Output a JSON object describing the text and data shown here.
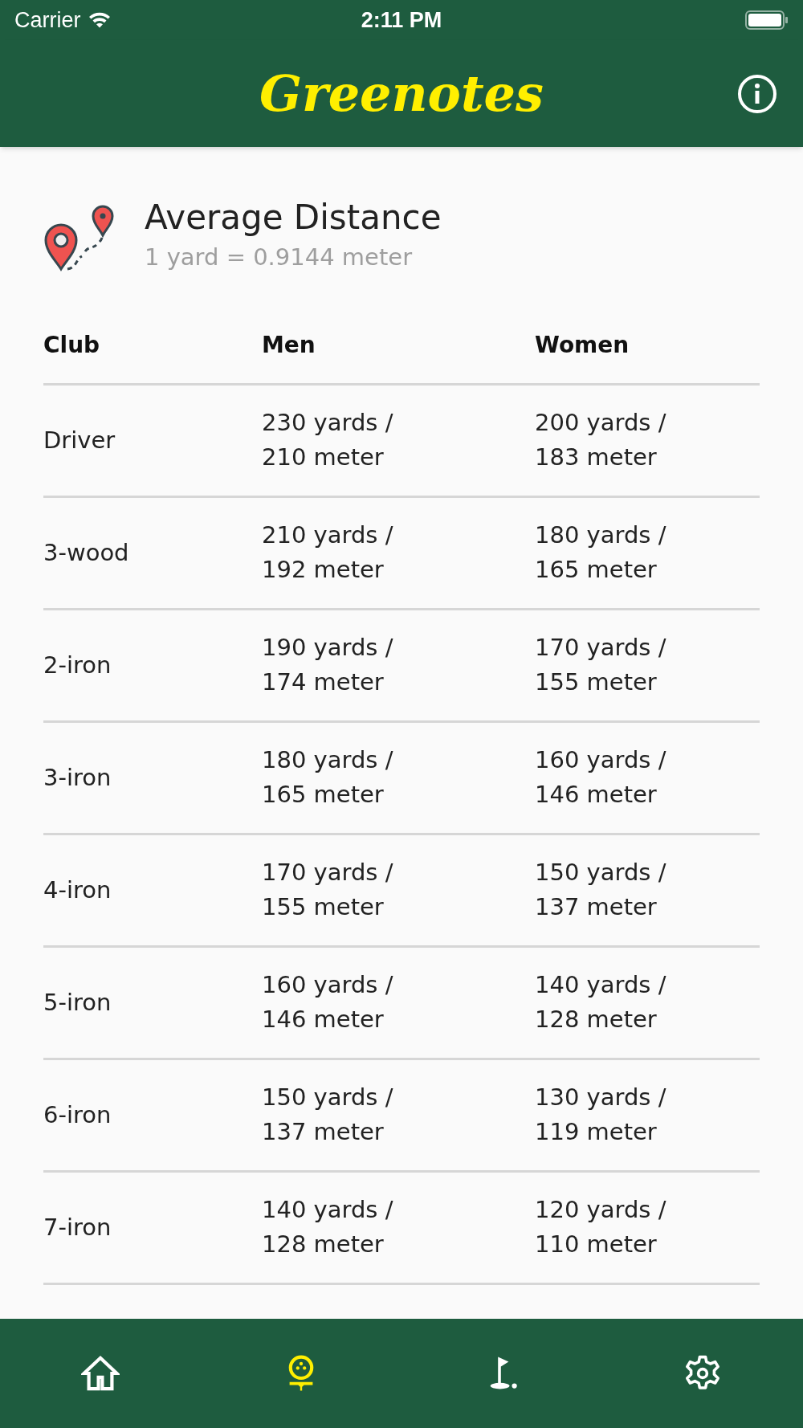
{
  "status_bar": {
    "carrier": "Carrier",
    "time": "2:11 PM"
  },
  "header": {
    "title": "Greenotes"
  },
  "section": {
    "title": "Average Distance",
    "subtitle": "1 yard = 0.9144 meter"
  },
  "table": {
    "columns": [
      "Club",
      "Men",
      "Women"
    ],
    "rows": [
      {
        "club": "Driver",
        "men": [
          "230 yards /",
          "210 meter"
        ],
        "women": [
          "200 yards /",
          "183 meter"
        ]
      },
      {
        "club": "3-wood",
        "men": [
          "210 yards /",
          "192 meter"
        ],
        "women": [
          "180 yards /",
          "165 meter"
        ]
      },
      {
        "club": "2-iron",
        "men": [
          "190 yards /",
          "174 meter"
        ],
        "women": [
          "170 yards /",
          "155 meter"
        ]
      },
      {
        "club": "3-iron",
        "men": [
          "180 yards /",
          "165 meter"
        ],
        "women": [
          "160 yards /",
          "146 meter"
        ]
      },
      {
        "club": "4-iron",
        "men": [
          "170 yards /",
          "155 meter"
        ],
        "women": [
          "150 yards /",
          "137 meter"
        ]
      },
      {
        "club": "5-iron",
        "men": [
          "160 yards /",
          "146 meter"
        ],
        "women": [
          "140 yards /",
          "128 meter"
        ]
      },
      {
        "club": "6-iron",
        "men": [
          "150 yards /",
          "137 meter"
        ],
        "women": [
          "130 yards /",
          "119 meter"
        ]
      },
      {
        "club": "7-iron",
        "men": [
          "140 yards /",
          "128 meter"
        ],
        "women": [
          "120 yards /",
          "110 meter"
        ]
      }
    ]
  },
  "tab_bar": [
    {
      "kind": "home",
      "selected": false
    },
    {
      "kind": "ball",
      "selected": true
    },
    {
      "kind": "flag",
      "selected": false
    },
    {
      "kind": "settings",
      "selected": false
    }
  ]
}
